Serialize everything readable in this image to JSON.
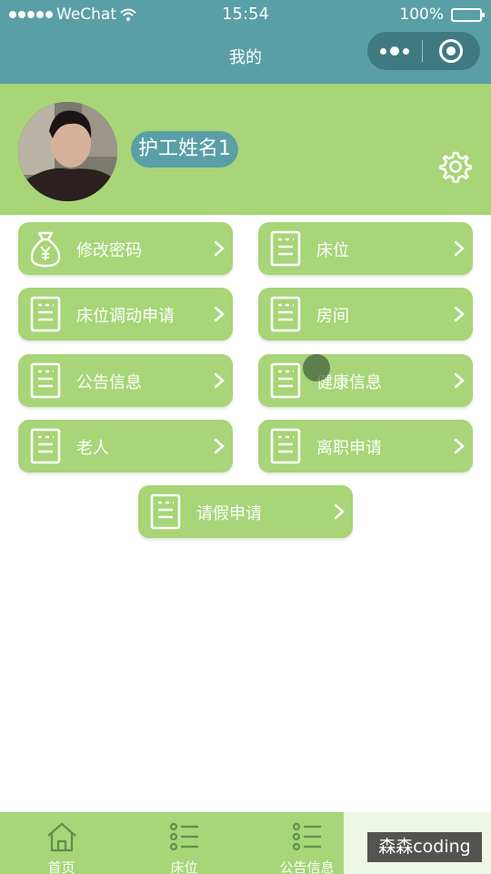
{
  "status_bar": {
    "carrier": "WeChat",
    "time": "15:54",
    "battery": "100%"
  },
  "nav": {
    "title": "我的"
  },
  "profile": {
    "name": "护工姓名1"
  },
  "menu": [
    {
      "label": "修改密码",
      "icon": "money-bag-icon"
    },
    {
      "label": "床位",
      "icon": "form-icon"
    },
    {
      "label": "床位调动申请",
      "icon": "form-icon"
    },
    {
      "label": "房间",
      "icon": "form-icon"
    },
    {
      "label": "公告信息",
      "icon": "form-icon"
    },
    {
      "label": "健康信息",
      "icon": "form-icon"
    },
    {
      "label": "老人",
      "icon": "form-icon"
    },
    {
      "label": "离职申请",
      "icon": "form-icon"
    },
    {
      "label": "请假申请",
      "icon": "form-icon"
    }
  ],
  "tabbar": [
    {
      "label": "首页",
      "icon": "home-icon"
    },
    {
      "label": "床位",
      "icon": "list-icon"
    },
    {
      "label": "公告信息",
      "icon": "list-icon"
    }
  ],
  "watermark": "森森coding",
  "colors": {
    "header": "#5a9fa6",
    "green": "#a7d577",
    "capsule": "#3e7a80"
  }
}
